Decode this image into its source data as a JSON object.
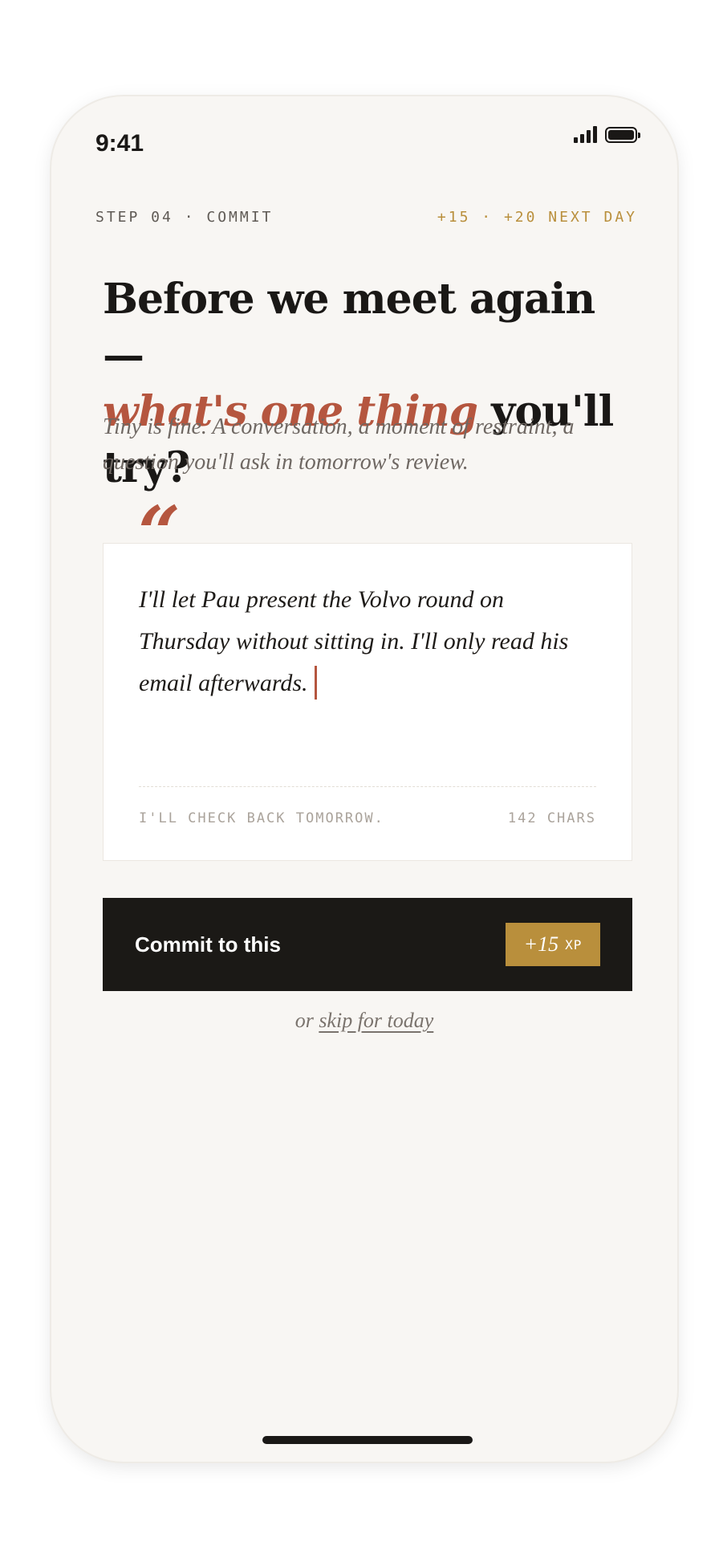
{
  "status_bar": {
    "time": "9:41"
  },
  "header": {
    "step_label": "STEP 04 · COMMIT",
    "xp_reward": "+15 · +20 NEXT DAY"
  },
  "headline": {
    "line1": "Before we meet again —",
    "accent": "what's one thing",
    "line2_rest": " you'll try?"
  },
  "subtitle": "Tiny is fine. A conversation, a moment of restraint, a question you'll ask in tomorrow's review.",
  "quote_mark": "“",
  "commitment": {
    "text": "I'll let Pau present the Volvo round on Thursday without sitting in. I'll only read his email afterwards.",
    "footer_left": "I'LL CHECK BACK TOMORROW.",
    "char_count": "142 CHARS"
  },
  "commit_button": {
    "label": "Commit to this",
    "xp_amount": "+15",
    "xp_unit": "XP"
  },
  "skip": {
    "prefix": "or ",
    "link": "skip for today"
  },
  "colors": {
    "accent": "#b5563f",
    "gold": "#b98f3c",
    "dark": "#1b1916",
    "background": "#f8f6f3"
  }
}
